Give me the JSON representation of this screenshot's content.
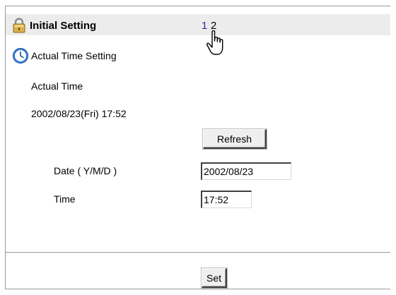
{
  "header": {
    "title": "Initial Setting",
    "pages": [
      "1",
      "2"
    ],
    "icon": "lock-icon"
  },
  "section": {
    "title": "Actual Time Setting",
    "icon": "clock-icon"
  },
  "actual_time": {
    "label": "Actual Time",
    "value": "2002/08/23(Fri) 17:52"
  },
  "buttons": {
    "refresh": "Refresh",
    "set": "Set"
  },
  "date_field": {
    "label": "Date ( Y/M/D )",
    "value": "2002/08/23"
  },
  "time_field": {
    "label": "Time",
    "value": "17:52"
  },
  "cursor": "hand-pointer-icon"
}
